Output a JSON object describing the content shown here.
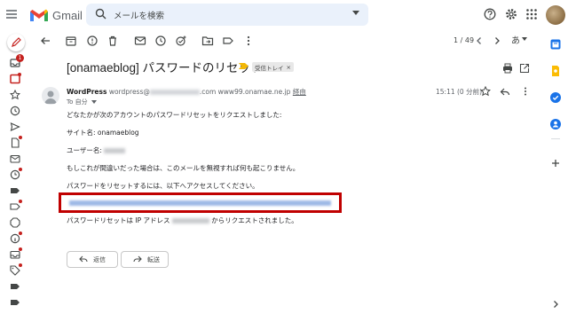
{
  "header": {
    "brand": "Gmail",
    "search_placeholder": "メールを検索"
  },
  "toolbar": {
    "pager": "1 / 49",
    "input_tool_label": "あ"
  },
  "message": {
    "subject": "[onamaeblog] パスワードのリセット",
    "label": "受信トレイ",
    "label_close": "×",
    "sender_name": "WordPress",
    "sender_addr_prefix": "wordpress@",
    "sender_addr_suffix": ".com www99.onamae.ne.jp",
    "unsubscribe": "経由",
    "to": "To 自分",
    "date": "15:11 (0 分前)",
    "lines": [
      "どなたかが次のアカウントのパスワードリセットをリクエストしました:",
      "サイト名: onamaeblog",
      "ユーザー名:",
      "もしこれが間違いだった場合は、このメールを無視すれば何も起こりません。",
      "パスワードをリセットするには、以下へアクセスしてください。",
      "パスワードリセットは IP アドレス",
      "からリクエストされました。"
    ]
  },
  "actions": {
    "reply": "返信",
    "forward": "転送"
  },
  "colors": {
    "gmail_red": "#ea4335",
    "highlight_border": "#c00000",
    "search_bg": "#eaf1fb",
    "notification_dot": "#c5221f"
  },
  "rail_badge": "1"
}
